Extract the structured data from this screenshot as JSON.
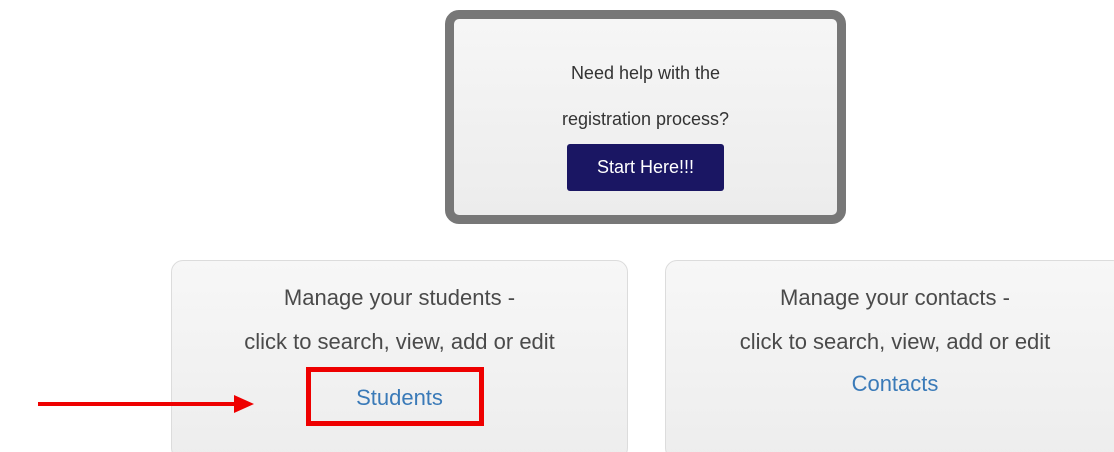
{
  "help": {
    "line1": "Need help with the",
    "line2": "registration process?",
    "button_label": "Start Here!!!"
  },
  "students_card": {
    "line1": "Manage your students -",
    "line2": "click to search, view, add or edit",
    "link_label": "Students"
  },
  "contacts_card": {
    "line1": "Manage your contacts -",
    "line2": "click to search, view, add or edit",
    "link_label": "Contacts"
  },
  "annotation": {
    "color": "#ee0000",
    "arrow": "right-arrow-icon",
    "highlight_target": "Students"
  },
  "colors": {
    "button_bg": "#1a1663",
    "link": "#3a7ab8",
    "help_border": "#777777"
  }
}
